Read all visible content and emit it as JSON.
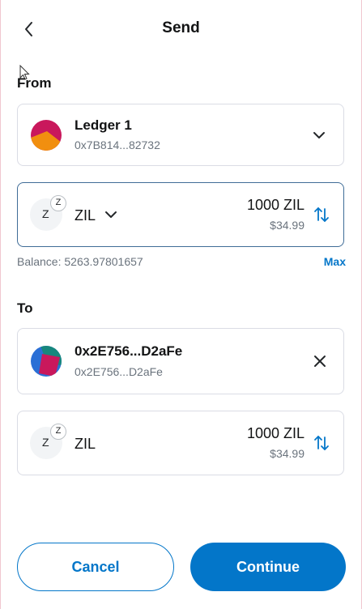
{
  "header": {
    "title": "Send"
  },
  "from": {
    "label": "From",
    "account": {
      "name": "Ledger 1",
      "address": "0x7B814...82732"
    },
    "asset": {
      "symbol": "ZIL",
      "badge_letter": "Z",
      "badge_mini": "Z",
      "amount": "1000 ZIL",
      "fiat": "$34.99"
    },
    "balance": "Balance: 5263.97801657",
    "max_label": "Max"
  },
  "to": {
    "label": "To",
    "recipient": {
      "name": "0x2E756...D2aFe",
      "address": "0x2E756...D2aFe"
    },
    "asset": {
      "symbol": "ZIL",
      "badge_letter": "Z",
      "badge_mini": "Z",
      "amount": "1000 ZIL",
      "fiat": "$34.99"
    }
  },
  "footer": {
    "cancel_label": "Cancel",
    "continue_label": "Continue"
  },
  "icons": {
    "back": "chevron-left-icon",
    "dropdown": "chevron-down-icon",
    "swap": "swap-vertical-icon",
    "close": "close-icon"
  },
  "colors": {
    "primary": "#0376c9",
    "muted": "#6a737d",
    "border": "#dadce5"
  }
}
